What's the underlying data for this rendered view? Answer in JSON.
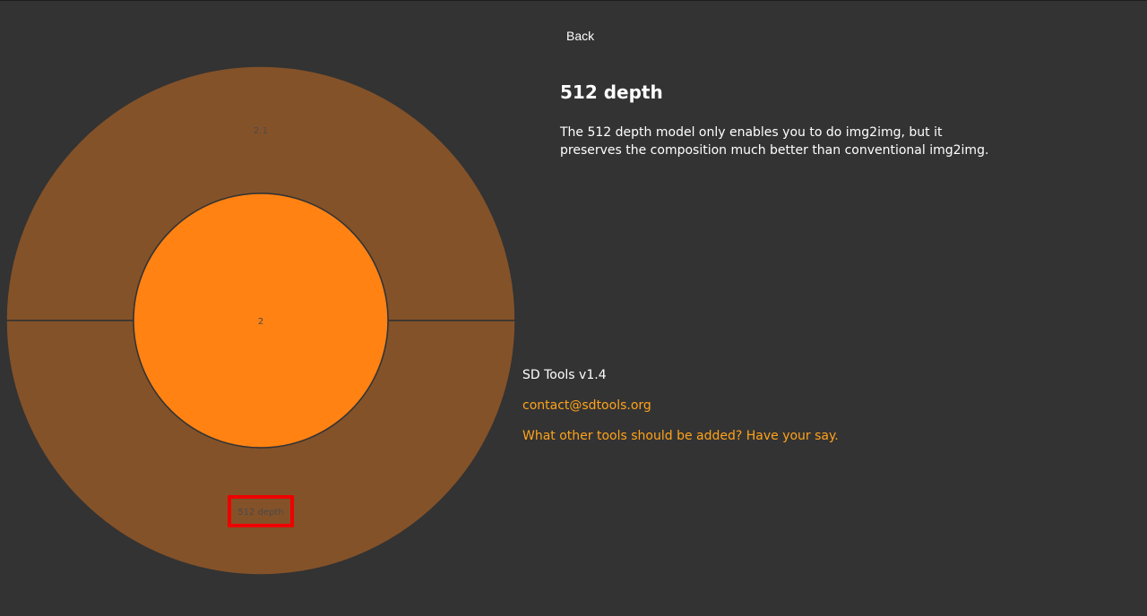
{
  "nav": {
    "back_label": "Back"
  },
  "detail": {
    "title": "512 depth",
    "description": "The 512 depth model only enables you to do img2img, but it preserves the composition much better than conventional img2img."
  },
  "footer": {
    "version": "SD Tools v1.4",
    "contact_email": "contact@sdtools.org",
    "feedback_link": "What other tools should be added? Have your say."
  },
  "chart_data": {
    "type": "sunburst",
    "nodes": [
      {
        "name": "2",
        "ring": "inner",
        "value": 1
      },
      {
        "name": "2.1",
        "ring": "outer",
        "parent": "2",
        "value": 0.5
      },
      {
        "name": "512 depth",
        "ring": "outer",
        "parent": "2",
        "value": 0.5,
        "highlighted": true
      }
    ],
    "colors": {
      "inner": "#ff8213",
      "outer": "#845229",
      "stroke": "#333333",
      "label": "#4a4a4a",
      "highlight": "#ee0000"
    }
  }
}
